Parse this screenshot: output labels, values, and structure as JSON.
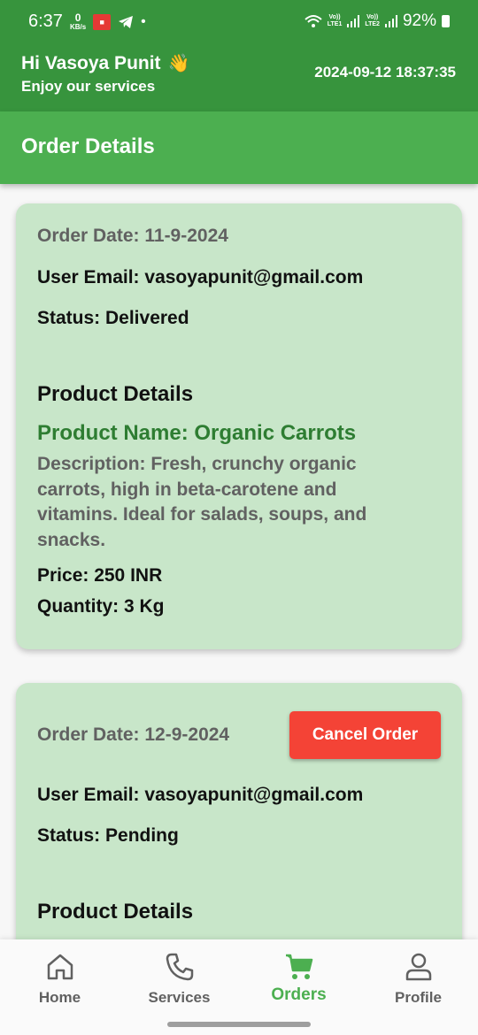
{
  "status_bar": {
    "time": "6:37",
    "net_speed_value": "0",
    "net_speed_unit": "KB/s",
    "lte1": "LTE1",
    "lte2": "LTE2",
    "volte": "Vo))",
    "battery": "92%"
  },
  "header": {
    "greeting": "Hi Vasoya Punit",
    "subtitle": "Enjoy our services",
    "datetime": "2024-09-12 18:37:35"
  },
  "page": {
    "title": "Order Details"
  },
  "orders": [
    {
      "order_date": "Order Date: 11-9-2024",
      "user_email": "User Email: vasoyapunit@gmail.com",
      "status": "Status: Delivered",
      "product_details_title": "Product Details",
      "product_name": "Product Name: Organic Carrots",
      "description_lines": [
        "Description: Fresh, crunchy organic",
        "carrots, high in beta-carotene and",
        "vitamins. Ideal for salads, soups, and",
        "snacks."
      ],
      "price": "Price: 250 INR",
      "quantity": "Quantity: 3 Kg"
    },
    {
      "order_date": "Order Date: 12-9-2024",
      "cancel_label": "Cancel Order",
      "user_email": "User Email: vasoyapunit@gmail.com",
      "status": "Status: Pending",
      "product_details_title": "Product Details"
    }
  ],
  "bottom_nav": {
    "items": [
      {
        "label": "Home",
        "icon": "home-icon",
        "active": false
      },
      {
        "label": "Services",
        "icon": "phone-icon",
        "active": false
      },
      {
        "label": "Orders",
        "icon": "cart-icon",
        "active": true
      },
      {
        "label": "Profile",
        "icon": "person-icon",
        "active": false
      }
    ]
  },
  "colors": {
    "header_green": "#37943d",
    "title_green": "#4caf50",
    "card_bg": "#c8e6c9",
    "product_name_green": "#2e7d32",
    "cancel_red": "#f44336",
    "active_nav": "#4caf50"
  }
}
